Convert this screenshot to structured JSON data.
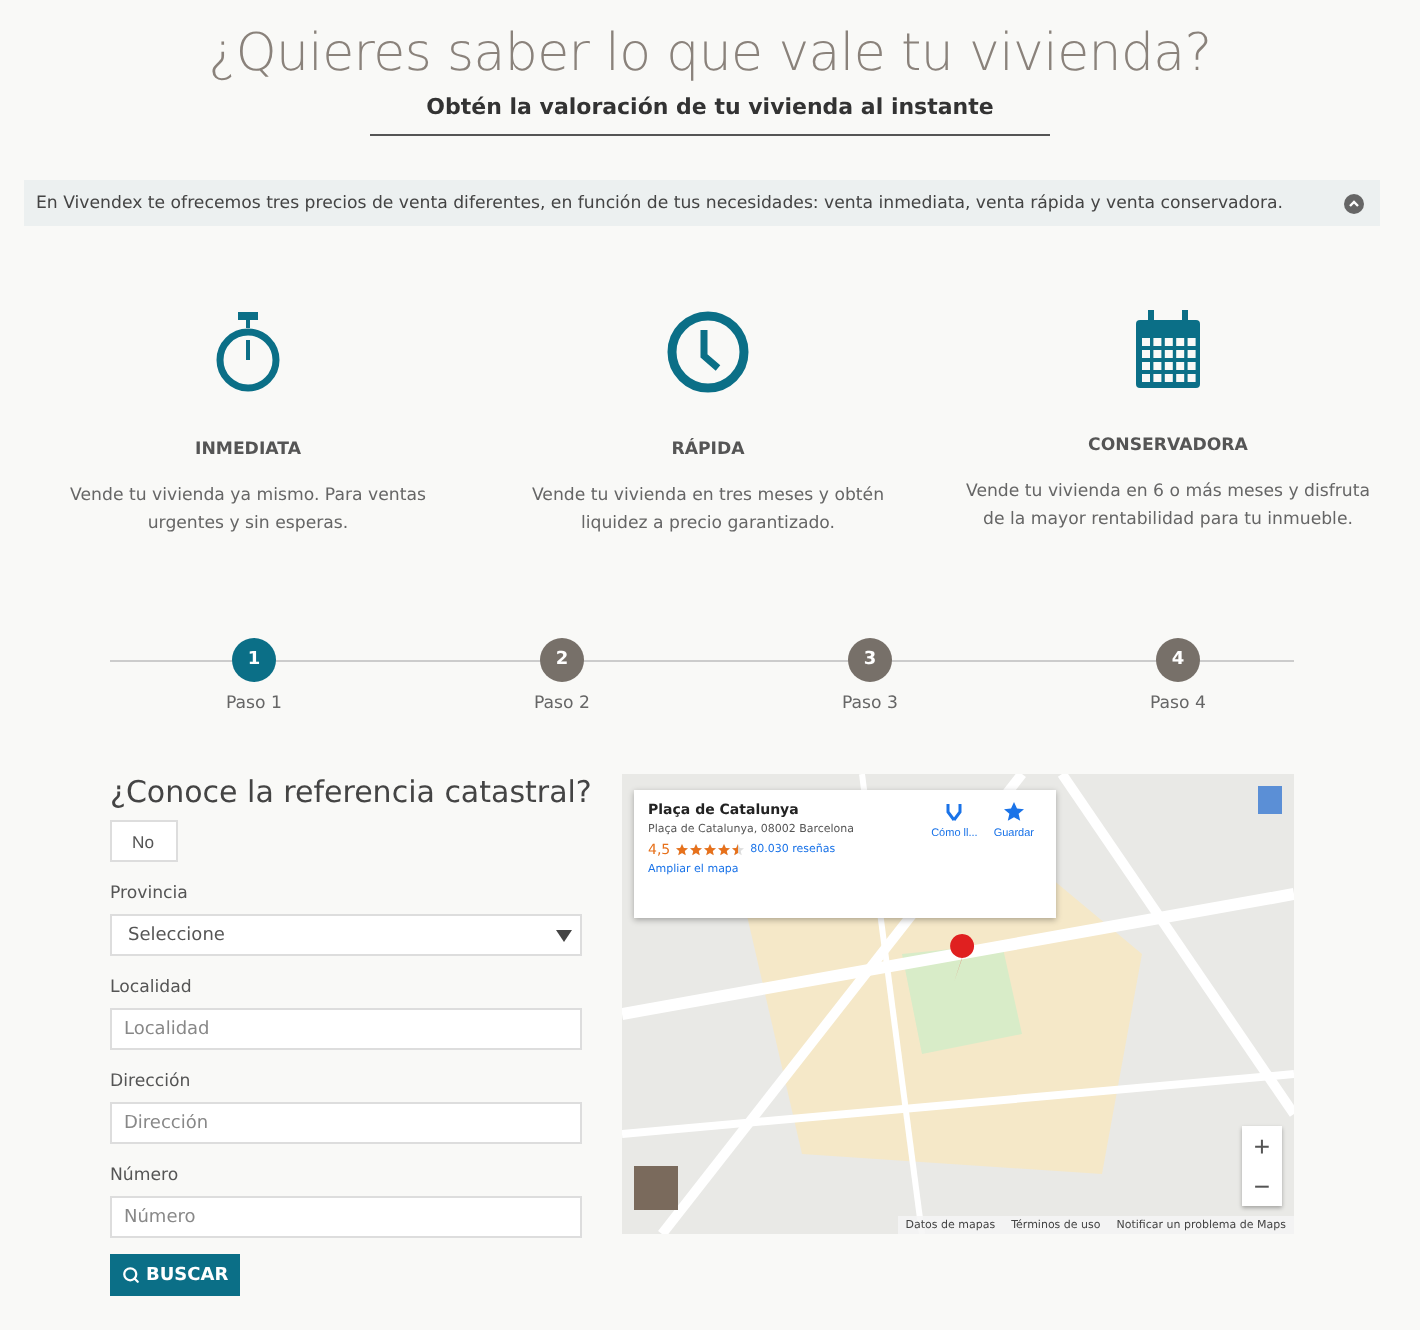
{
  "header": {
    "title": "¿Quieres saber lo que vale tu vivienda?",
    "subtitle": "Obtén la valoración de tu vivienda al instante"
  },
  "info_bar": {
    "text": "En Vivendex te ofrecemos tres precios de venta diferentes, en función de tus necesidades: venta inmediata, venta rápida y venta conservadora."
  },
  "features": [
    {
      "kind": "stopwatch",
      "title": "INMEDIATA",
      "text": "Vende tu vivienda ya mismo. Para ventas urgentes y sin esperas."
    },
    {
      "kind": "clock",
      "title": "RÁPIDA",
      "text": "Vende tu vivienda en tres meses y obtén liquidez a precio garantizado."
    },
    {
      "kind": "calendar",
      "title": "CONSERVADORA",
      "text": "Vende tu vivienda en 6 o más meses y disfruta de la mayor rentabilidad para tu inmueble."
    }
  ],
  "steps": [
    {
      "number": "1",
      "label": "Paso 1",
      "selected": true
    },
    {
      "number": "2",
      "label": "Paso 2",
      "selected": false
    },
    {
      "number": "3",
      "label": "Paso 3",
      "selected": false
    },
    {
      "number": "4",
      "label": "Paso 4",
      "selected": false
    }
  ],
  "form": {
    "question": "¿Conoce la referencia catastral?",
    "toggle": {
      "label": "No",
      "on": false
    },
    "fields": [
      {
        "kind": "select",
        "label": "Provincia",
        "value": "Seleccione"
      },
      {
        "kind": "input",
        "label": "Localidad",
        "placeholder": "Localidad"
      },
      {
        "kind": "input",
        "label": "Dirección",
        "placeholder": "Dirección"
      },
      {
        "kind": "input",
        "label": "Número",
        "placeholder": "Número"
      }
    ],
    "button": "BUSCAR"
  },
  "map": {
    "kind": "picture",
    "card": {
      "title": "Plaça de Catalunya",
      "address": "Plaça de Catalunya, 08002 Barcelona",
      "rating": "4,5",
      "stars": 4.5,
      "reviews": "80.030 reseñas",
      "link": "Ampliar el mapa",
      "actions": [
        {
          "kind": "directions",
          "label": "Cómo ll..."
        },
        {
          "kind": "save",
          "label": "Guardar"
        }
      ]
    },
    "zoom": [
      "+",
      "−"
    ],
    "footer": [
      "Datos de mapas",
      "Términos de uso",
      "Notificar un problema de Maps"
    ]
  }
}
